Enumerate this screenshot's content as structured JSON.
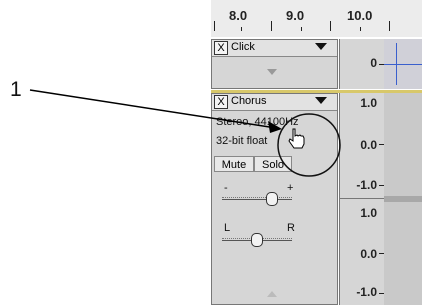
{
  "ruler": {
    "ticks": [
      "8.0",
      "9.0",
      "10.0"
    ]
  },
  "callout": {
    "number": "1"
  },
  "click_track": {
    "name": "Click",
    "close": "X",
    "scale_value": "0"
  },
  "chorus_track": {
    "name": "Chorus",
    "close": "X",
    "info_line1": "Stereo, 44100Hz",
    "info_line2": "32-bit float",
    "mute_label": "Mute",
    "solo_label": "Solo",
    "gain_minus": "-",
    "gain_plus": "+",
    "pan_left": "L",
    "pan_right": "R",
    "scale_top": [
      "1.0",
      "0.0",
      "-1.0"
    ],
    "scale_bottom": [
      "1.0",
      "0.0",
      "-1.0"
    ]
  },
  "colors": {
    "panel": "#d6d6d6",
    "wave_line": "#3a5fcd",
    "track_border": "#d8c86a"
  }
}
